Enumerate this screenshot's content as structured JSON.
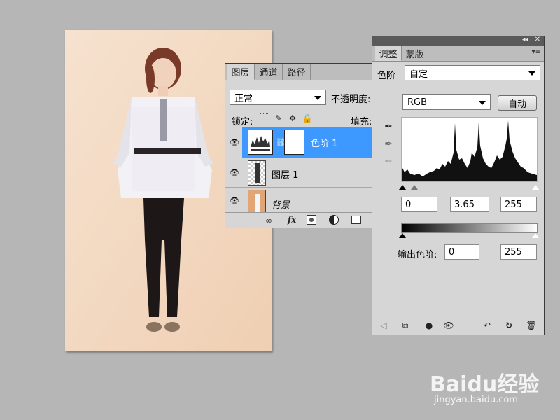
{
  "layers_panel": {
    "tabs": [
      {
        "label": "图层",
        "active": true
      },
      {
        "label": "通道",
        "active": false
      },
      {
        "label": "路径",
        "active": false
      }
    ],
    "blend_mode": "正常",
    "opacity_label": "不透明度:",
    "lock_label": "锁定:",
    "fill_label": "填充:",
    "layers": [
      {
        "name": "色阶 1",
        "selected": true,
        "visible": true
      },
      {
        "name": "图层 1",
        "selected": false,
        "visible": true
      },
      {
        "name": "背景",
        "selected": false,
        "visible": true
      }
    ],
    "footer_icons": [
      "link-icon",
      "fx-icon",
      "mask-icon",
      "adjustment-icon",
      "folder-icon"
    ],
    "fx_label": "fx"
  },
  "adjustments_panel": {
    "tabs": [
      {
        "label": "调整",
        "active": true
      },
      {
        "label": "蒙版",
        "active": false
      }
    ],
    "type_label": "色阶",
    "preset": "自定",
    "channel": "RGB",
    "auto_button": "自动",
    "input_values": {
      "black": "0",
      "gamma": "3.65",
      "white": "255"
    },
    "output_label": "输出色阶:",
    "output_values": {
      "black": "0",
      "white": "255"
    },
    "footer_icons": [
      "back-icon",
      "clip-icon",
      "mask-toggle-icon",
      "visibility-icon",
      "previous-state-icon",
      "reset-icon",
      "delete-icon"
    ]
  },
  "watermark": {
    "brand": "Baidu经验",
    "url": "jingyan.baidu.com"
  },
  "colors": {
    "selection": "#3d98ff",
    "panel": "#d6d6d6",
    "tabbar": "#bdbdbd",
    "canvas_bg": "#f3d9c3",
    "workspace": "#b6b6b6"
  }
}
